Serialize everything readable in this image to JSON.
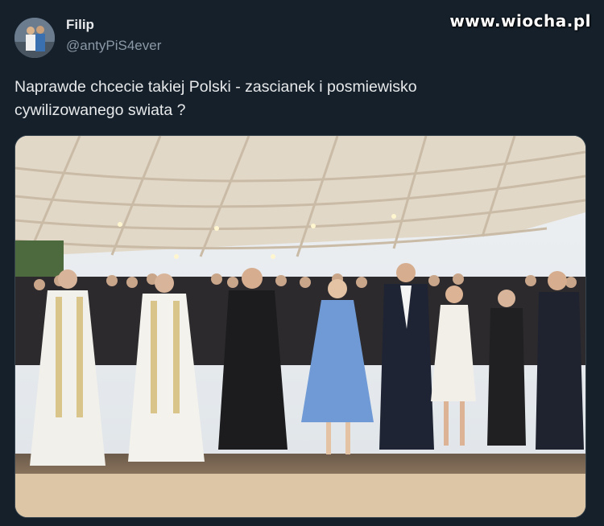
{
  "tweet": {
    "author_name": "Filip",
    "author_handle": "@antyPiS4ever",
    "text_line1": "Naprawde chcecie takiej Polski - zascianek i posmiewisko",
    "text_line2": "cywilizowanego swiata ?"
  },
  "watermark": "www.wiocha.pl",
  "icons": {
    "avatar": "avatar-image",
    "photo": "attached-photo"
  },
  "colors": {
    "background": "#15202b",
    "text": "#e7e9ea",
    "secondary_text": "#8b98a5"
  }
}
